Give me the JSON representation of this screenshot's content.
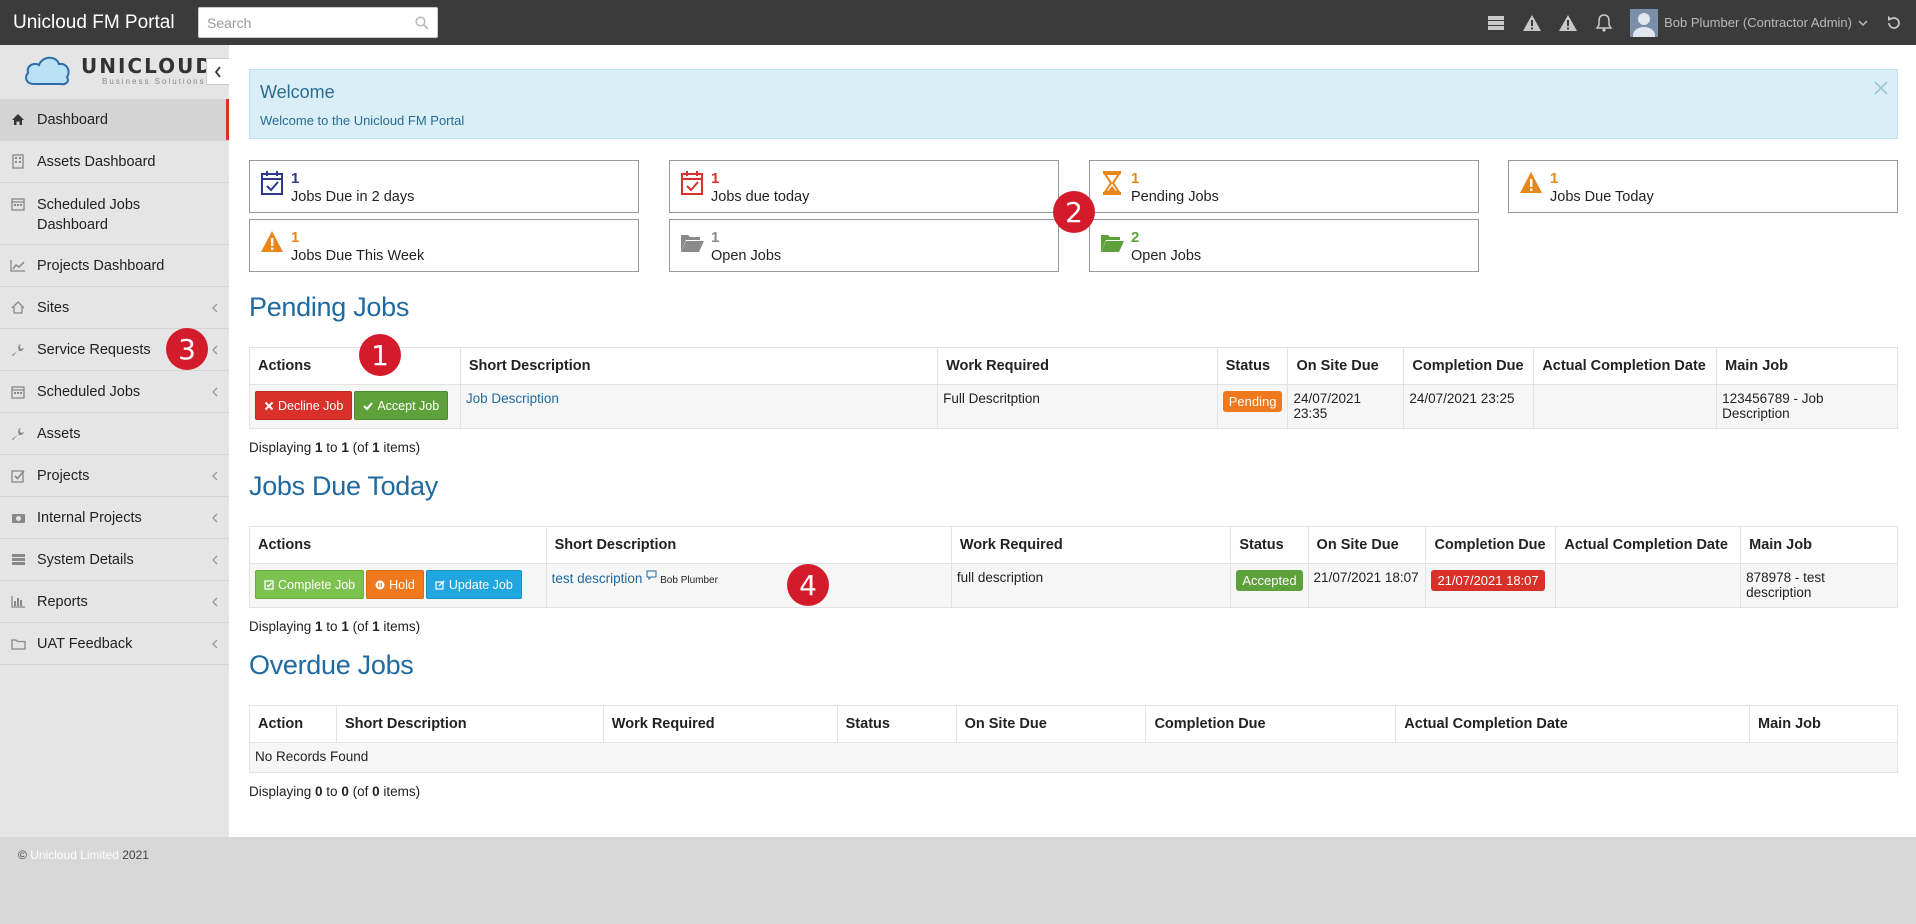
{
  "app": {
    "title": "Unicloud FM Portal"
  },
  "search": {
    "placeholder": "Search"
  },
  "user": {
    "name": "Bob Plumber (Contractor Admin)"
  },
  "logo": {
    "name": "UNICLOUD",
    "tagline": "Business Solutions"
  },
  "sidebar": {
    "items": [
      {
        "label": "Dashboard",
        "icon": "home-icon"
      },
      {
        "label": "Assets Dashboard",
        "icon": "building-icon"
      },
      {
        "label": "Scheduled Jobs Dashboard",
        "icon": "calendar-icon"
      },
      {
        "label": "Projects Dashboard",
        "icon": "line-chart-icon"
      },
      {
        "label": "Sites",
        "icon": "home-outline-icon"
      },
      {
        "label": "Service Requests",
        "icon": "wrench-icon"
      },
      {
        "label": "Scheduled Jobs",
        "icon": "calendar-icon"
      },
      {
        "label": "Assets",
        "icon": "wrench-icon"
      },
      {
        "label": "Projects",
        "icon": "check-square-icon"
      },
      {
        "label": "Internal Projects",
        "icon": "camera-icon"
      },
      {
        "label": "System Details",
        "icon": "server-icon"
      },
      {
        "label": "Reports",
        "icon": "bar-chart-icon"
      },
      {
        "label": "UAT Feedback",
        "icon": "folder-icon"
      }
    ]
  },
  "footer": {
    "copyright": "©",
    "brand": "Unicloud Limited",
    "year": "2021"
  },
  "welcome": {
    "title": "Welcome",
    "text": "Welcome to the Unicloud FM Portal"
  },
  "stats": [
    {
      "count": "1",
      "label": "Jobs Due in 2 days",
      "color": "#2b3a8f",
      "icon": "calendar-check-icon"
    },
    {
      "count": "1",
      "label": "Jobs due today",
      "color": "#d9312a",
      "icon": "calendar-check-icon"
    },
    {
      "count": "1",
      "label": "Pending Jobs",
      "color": "#e8861a",
      "icon": "hourglass-icon"
    },
    {
      "count": "1",
      "label": "Jobs Due Today",
      "color": "#e8861a",
      "icon": "warning-icon"
    },
    {
      "count": "1",
      "label": "Jobs Due This Week",
      "color": "#e8861a",
      "icon": "warning-icon"
    },
    {
      "count": "1",
      "label": "Open Jobs",
      "color": "#8a8a8a",
      "icon": "folder-open-icon"
    },
    {
      "count": "2",
      "label": "Open Jobs",
      "color": "#5ea13a",
      "icon": "folder-open-icon"
    }
  ],
  "pending": {
    "title": "Pending Jobs",
    "headers": [
      "Actions",
      "Short Description",
      "Work Required",
      "Status",
      "On Site Due",
      "Completion Due",
      "Actual Completion Date",
      "Main Job"
    ],
    "decline": "Decline Job",
    "accept": "Accept Job",
    "row": {
      "short": "Job Description",
      "work": "Full Descritption",
      "status": "Pending",
      "onsite": "24/07/2021 23:35",
      "completion": "24/07/2021 23:25",
      "actual": "",
      "main": "123456789 - Job Description"
    },
    "display": {
      "pre": "Displaying ",
      "from": "1",
      "mid": " to ",
      "to": "1",
      "of_pre": " (of ",
      "total": "1",
      "post": " items)"
    }
  },
  "today": {
    "title": "Jobs Due Today",
    "headers": [
      "Actions",
      "Short Description",
      "Work Required",
      "Status",
      "On Site Due",
      "Completion Due",
      "Actual Completion Date",
      "Main Job"
    ],
    "complete": "Complete Job",
    "hold": "Hold",
    "update": "Update Job",
    "row": {
      "short": "test description",
      "user": "Bob Plumber",
      "work": "full description",
      "status": "Accepted",
      "onsite": "21/07/2021 18:07",
      "completion": "21/07/2021 18:07",
      "actual": "",
      "main": "878978 - test description"
    },
    "display": {
      "pre": "Displaying ",
      "from": "1",
      "mid": " to ",
      "to": "1",
      "of_pre": " (of ",
      "total": "1",
      "post": " items)"
    }
  },
  "overdue": {
    "title": "Overdue Jobs",
    "headers": [
      "Action",
      "Short Description",
      "Work Required",
      "Status",
      "On Site Due",
      "Completion Due",
      "Actual Completion Date",
      "Main Job"
    ],
    "empty": "No Records Found",
    "display": {
      "pre": "Displaying ",
      "from": "0",
      "mid": " to ",
      "to": "0",
      "of_pre": " (of ",
      "total": "0",
      "post": " items)"
    }
  },
  "markers": [
    "1",
    "2",
    "3",
    "4"
  ]
}
